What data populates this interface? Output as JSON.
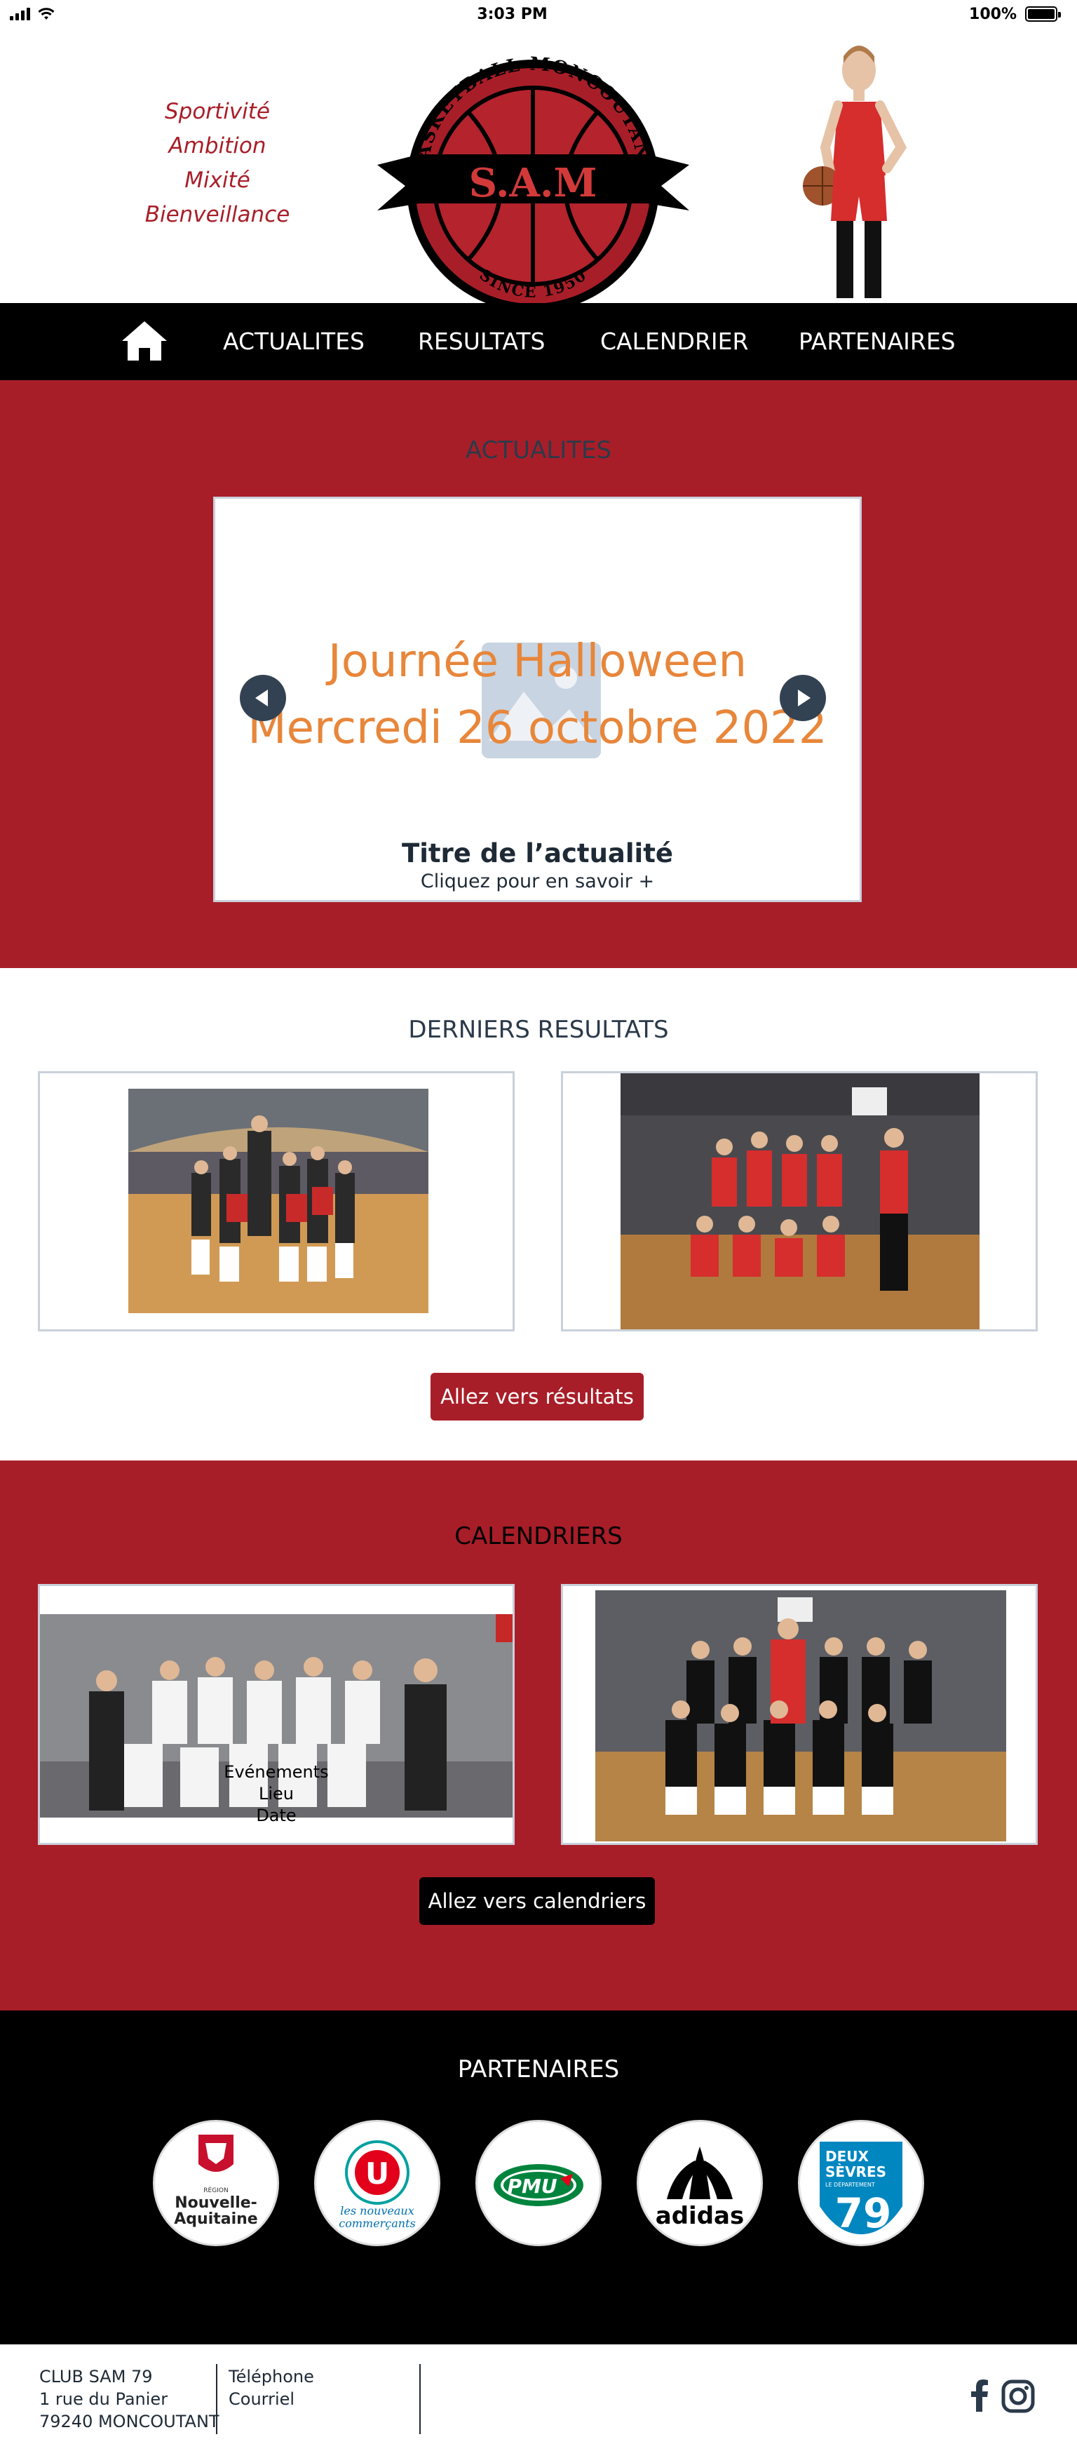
{
  "status_bar": {
    "time": "3:03 PM",
    "battery": "100%",
    "battery_level": 1.0
  },
  "header": {
    "slogans": [
      "Sportivité",
      "Ambition",
      "Mixité",
      "Bienveillance"
    ],
    "logo": {
      "arc_text": "BASKETBALL MONCOUTANT",
      "banner_text": "S.A.M",
      "bottom_text": "SINCE 1950"
    }
  },
  "nav": {
    "home_icon": "home-icon",
    "items": [
      "ACTUALITES",
      "RESULTATS",
      "CALENDRIER",
      "PARTENAIRES"
    ]
  },
  "actualites": {
    "heading": "ACTUALITES",
    "headline_line1": "Journée Halloween",
    "headline_line2": "Mercredi 26 octobre 2022",
    "card_title": "Titre de l’actualité",
    "card_subtitle": "Cliquez pour en savoir +"
  },
  "resultats": {
    "heading": "DERNIERS RESULTATS",
    "button": "Allez vers résultats"
  },
  "calendriers": {
    "heading": "CALENDRIERS",
    "event_lines": [
      "Evénements",
      "Lieu",
      "Date"
    ],
    "button": "Allez vers calendriers"
  },
  "partenaires": {
    "heading": "PARTENAIRES",
    "logos": {
      "region": {
        "line1": "RÉGION",
        "line2": "Nouvelle-",
        "line3": "Aquitaine"
      },
      "u": {
        "letter": "U",
        "line1": "les nouveaux",
        "line2": "commerçants"
      },
      "pmu": {
        "text": "PMU"
      },
      "adidas": {
        "text": "adidas"
      },
      "deux_sevres": {
        "line1": "DEUX",
        "line2": "SÈVRES",
        "line3": "LE DÉPARTEMENT",
        "number": "79"
      }
    }
  },
  "footer": {
    "address": [
      "CLUB SAM 79",
      "1 rue du Panier",
      "79240 MONCOUTANT"
    ],
    "contact": [
      "Téléphone",
      "Courriel"
    ],
    "social_icons": [
      "facebook-icon",
      "instagram-icon"
    ]
  },
  "colors": {
    "brand_red": "#a81e28",
    "accent_orange": "#e8863a",
    "dark": "#000000"
  }
}
